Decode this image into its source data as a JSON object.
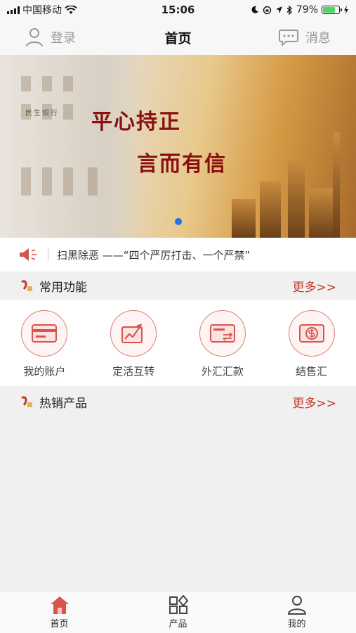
{
  "status_bar": {
    "carrier": "中国移动",
    "time": "15:06",
    "battery_percent": "79%",
    "battery_level": 0.79,
    "icons": [
      "signal-icon",
      "wifi-icon",
      "moon-icon",
      "location-icon",
      "bluetooth-icon",
      "battery-icon",
      "charging-icon"
    ]
  },
  "nav": {
    "login_label": "登录",
    "title": "首页",
    "messages_label": "消息"
  },
  "banner": {
    "line1": "平心持正",
    "line2": "言而有信",
    "sign": "民生银行",
    "active_slide": 1,
    "slide_count": 1
  },
  "notice": {
    "text": "扫黑除恶 ——“四个严厉打击、一个严禁”"
  },
  "common_functions": {
    "title": "常用功能",
    "more": "更多>>",
    "items": [
      {
        "label": "我的账户",
        "icon": "card-icon"
      },
      {
        "label": "定活互转",
        "icon": "chart-up-icon"
      },
      {
        "label": "外汇汇款",
        "icon": "transfer-card-icon"
      },
      {
        "label": "结售汇",
        "icon": "exchange-icon"
      }
    ]
  },
  "hot_products": {
    "title": "热销产品",
    "more": "更多>>"
  },
  "tab_bar": {
    "tabs": [
      {
        "label": "首页",
        "icon": "home-icon"
      },
      {
        "label": "产品",
        "icon": "products-grid-icon"
      },
      {
        "label": "我的",
        "icon": "user-icon"
      }
    ]
  },
  "colors": {
    "accent": "#c0392b",
    "brand_red": "#d9534f",
    "dot_blue": "#1a73e8",
    "battery_green": "#4cd964"
  }
}
